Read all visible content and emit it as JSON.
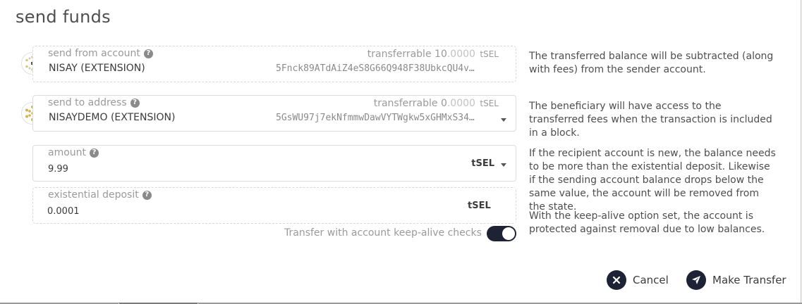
{
  "modal": {
    "title": "send funds"
  },
  "from": {
    "label": "send from account",
    "transferrable_label": "transferrable",
    "transferrable_int": "10",
    "transferrable_dec": ".0000",
    "unit": "tSEL",
    "name": "NISAY (EXTENSION)",
    "address": "5Fnck89ATdAiZ4eS8G66Q948F38UbkcQU4v…"
  },
  "to": {
    "label": "send to address",
    "transferrable_label": "transferrable",
    "transferrable_int": "0",
    "transferrable_dec": ".0000",
    "unit": "tSEL",
    "name": "NISAYDEMO (EXTENSION)",
    "address": "5GsWU97j7ekNfmmwDawVYTWgkw5xGHMxS34…"
  },
  "amount": {
    "label": "amount",
    "value": "9.99",
    "unit": "tSEL"
  },
  "existential": {
    "label": "existential deposit",
    "value": "0.0001",
    "unit": "tSEL"
  },
  "help": {
    "from": "The transferred balance will be subtracted (along with fees) from the sender account.",
    "to": "The beneficiary will have access to the transferred fees when the transaction is included in a block.",
    "amount": "If the recipient account is new, the balance needs to be more than the existential deposit. Likewise if the sending account balance drops below the same value, the account will be removed from the state.",
    "keepalive": "With the keep-alive option set, the account is protected against removal due to low balances."
  },
  "keepalive": {
    "label": "Transfer with account keep-alive checks",
    "enabled": true
  },
  "actions": {
    "cancel": "Cancel",
    "submit": "Make Transfer"
  },
  "colors": {
    "accent": "#1e2235",
    "text": "#4e4e4e",
    "muted": "#9a9a9a"
  }
}
